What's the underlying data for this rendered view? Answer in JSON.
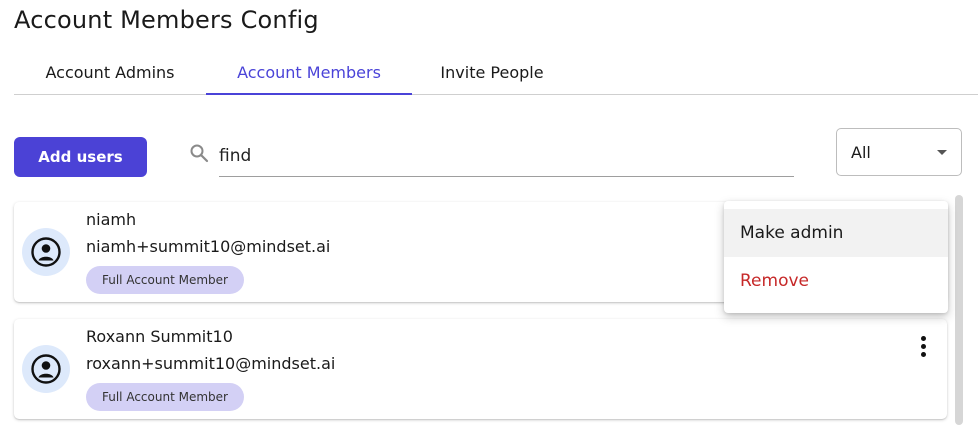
{
  "page": {
    "title": "Account Members Config"
  },
  "tabs": [
    {
      "label": "Account Admins",
      "active": false
    },
    {
      "label": "Account Members",
      "active": true
    },
    {
      "label": "Invite People",
      "active": false
    }
  ],
  "toolbar": {
    "add_label": "Add users",
    "search_icon": "search-icon",
    "search_value": "find",
    "filter_value": "All"
  },
  "members": [
    {
      "name": "niamh",
      "email": "niamh+summit10@mindset.ai",
      "role": "Full Account Member"
    },
    {
      "name": "Roxann Summit10",
      "email": "roxann+summit10@mindset.ai",
      "role": "Full Account Member"
    }
  ],
  "context_menu": {
    "make_admin": "Make admin",
    "remove": "Remove"
  },
  "colors": {
    "accent": "#4b42d6",
    "badge_bg": "#d3d0f5",
    "danger": "#c62828",
    "avatar_bg": "#dde9fb"
  }
}
